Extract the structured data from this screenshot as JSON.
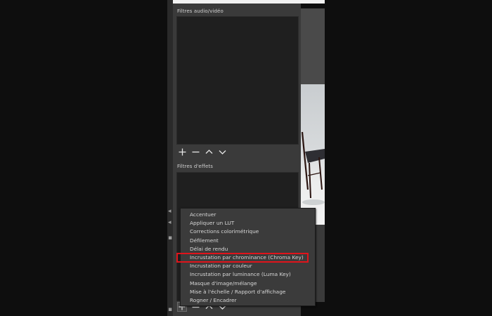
{
  "panel": {
    "audio_video_filters_label": "Filtres audio/vidéo",
    "effect_filters_label": "Filtres d'effets"
  },
  "toolbar": {
    "add_glyph": "+",
    "remove_glyph": "−"
  },
  "context_menu": {
    "items": [
      "Accentuer",
      "Appliquer un LUT",
      "Corrections colorimétrique",
      "Défilement",
      "Délai de rendu",
      "Incrustation par chrominance (Chroma Key)",
      "Incrustation par couleur",
      "Incrustation par luminance (Luma Key)",
      "Masque d'image/mélange",
      "Mise à l'échelle / Rapport d'affichage",
      "Rogner / Encadrer"
    ],
    "highlighted_index": 5
  },
  "colors": {
    "highlight_outline": "#e0141b",
    "panel_bg": "#3a3a3a",
    "list_bg": "#1f1f1f"
  }
}
